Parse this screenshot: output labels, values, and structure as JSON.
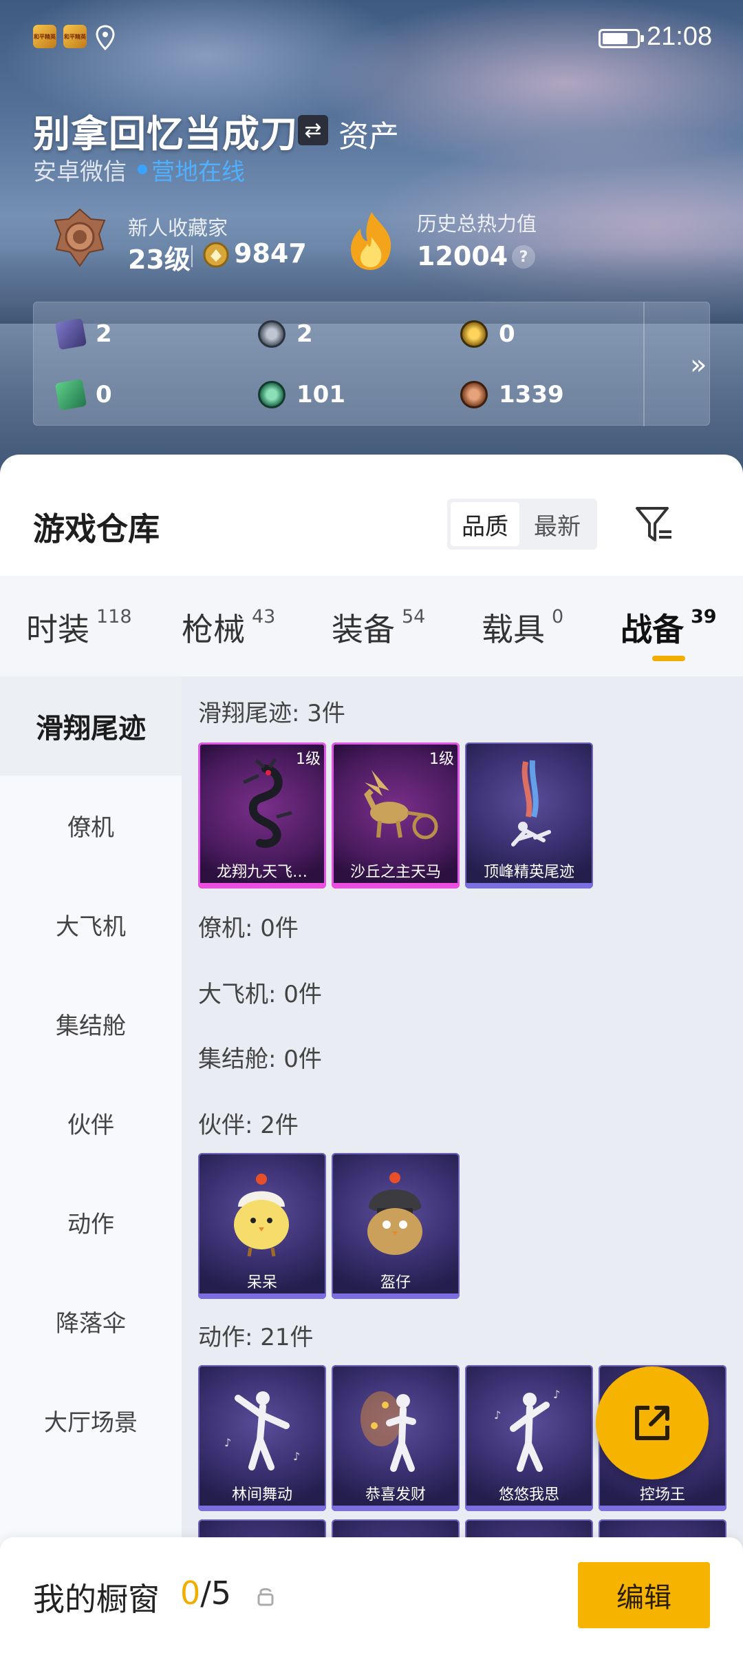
{
  "status_bar": {
    "time": "21:08",
    "app_icon_label": "和平精英"
  },
  "profile": {
    "name": "别拿回忆当成刀",
    "assets_label": "资产",
    "platform": "安卓微信",
    "online_status": "营地在线",
    "collector_title": "新人收藏家",
    "level": "23级",
    "coins": "9847",
    "heat_title": "历史总热力值",
    "heat_value": "12004",
    "help": "?"
  },
  "currencies": [
    {
      "icon": "purple-card-icon",
      "value": "2"
    },
    {
      "icon": "silver-coin-icon",
      "value": "2"
    },
    {
      "icon": "gold-coin-icon",
      "value": "0"
    },
    {
      "icon": "green-card-icon",
      "value": "0"
    },
    {
      "icon": "green-coin-icon",
      "value": "101"
    },
    {
      "icon": "bronze-coin-icon",
      "value": "1339"
    }
  ],
  "warehouse": {
    "title": "游戏仓库",
    "sort_quality": "品质",
    "sort_latest": "最新"
  },
  "category_tabs": [
    {
      "label": "时装",
      "count": "118"
    },
    {
      "label": "枪械",
      "count": "43"
    },
    {
      "label": "装备",
      "count": "54"
    },
    {
      "label": "载具",
      "count": "0"
    },
    {
      "label": "战备",
      "count": "39"
    }
  ],
  "sidebar": [
    "滑翔尾迹",
    "僚机",
    "大飞机",
    "集结舱",
    "伙伴",
    "动作",
    "降落伞",
    "大厅场景"
  ],
  "sections": {
    "glide": "滑翔尾迹: 3件",
    "wingman": "僚机: 0件",
    "plane": "大飞机: 0件",
    "capsule": "集结舱: 0件",
    "partner": "伙伴: 2件",
    "emote": "动作: 21件"
  },
  "items": {
    "glide": [
      {
        "name": "龙翔九天飞…",
        "level": "1级"
      },
      {
        "name": "沙丘之主天马",
        "level": "1级"
      },
      {
        "name": "顶峰精英尾迹"
      }
    ],
    "partner": [
      {
        "name": "呆呆"
      },
      {
        "name": "盔仔"
      }
    ],
    "emote": [
      {
        "name": "林间舞动"
      },
      {
        "name": "恭喜发财"
      },
      {
        "name": "悠悠我思"
      },
      {
        "name": "控场王"
      }
    ]
  },
  "showcase": {
    "title": "我的橱窗",
    "current": "0",
    "total": "/5",
    "edit": "编辑"
  },
  "colors": {
    "accent": "#f6b300",
    "online": "#3aa3ff",
    "legendary_border": "#e056e6",
    "epic_border": "#7b6fe0"
  }
}
